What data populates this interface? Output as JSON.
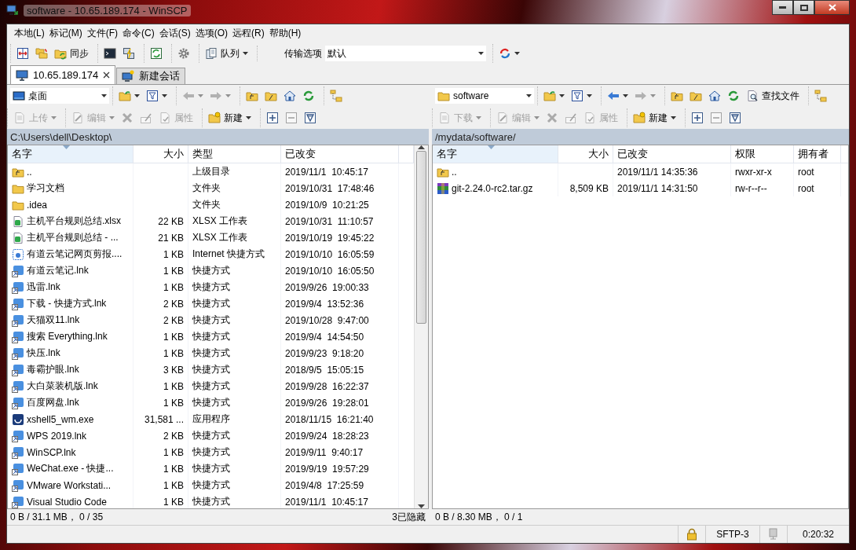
{
  "window": {
    "title": "software - 10.65.189.174 - WinSCP"
  },
  "menu": [
    "本地(L)",
    "标记(M)",
    "文件(F)",
    "命令(C)",
    "会话(S)",
    "选项(O)",
    "远程(R)",
    "帮助(H)"
  ],
  "toolbar": {
    "groups": [
      [
        {
          "kind": "compare"
        },
        {
          "kind": "sync-browse"
        },
        {
          "kind": "synchronize",
          "label": "同步"
        }
      ],
      [
        {
          "kind": "console"
        },
        {
          "kind": "external-terminal"
        }
      ],
      [
        {
          "kind": "refresh-session"
        }
      ],
      [
        {
          "kind": "preferences"
        }
      ],
      [
        {
          "kind": "queue",
          "label": "队列",
          "dropdown": true
        }
      ],
      [
        {
          "kind": "transfer",
          "label": "传输选项",
          "value": "默认"
        }
      ],
      [
        {
          "kind": "reconnect",
          "dropdown": true
        }
      ]
    ]
  },
  "tabs": [
    {
      "kind": "session",
      "label": "10.65.189.174",
      "selected": true,
      "closable": true
    },
    {
      "kind": "new-session",
      "label": "新建会话",
      "selected": false,
      "closable": false
    }
  ],
  "panels": [
    {
      "location": {
        "kind": "desktop",
        "value": "桌面"
      },
      "nav": [
        [
          {
            "kind": "open-folder",
            "disabled": false,
            "dropdown": true
          },
          {
            "kind": "filter",
            "disabled": false,
            "dropdown": true
          }
        ],
        [
          {
            "kind": "back",
            "disabled": true,
            "dropdown": true
          },
          {
            "kind": "forward",
            "disabled": true,
            "dropdown": true
          }
        ],
        [
          {
            "kind": "parent-folder",
            "disabled": false
          },
          {
            "kind": "root-folder",
            "disabled": false
          },
          {
            "kind": "home",
            "disabled": false
          },
          {
            "kind": "refresh",
            "disabled": false
          }
        ],
        [
          {
            "kind": "tree",
            "disabled": false
          }
        ]
      ],
      "actions": [
        [
          {
            "kind": "upload",
            "label": "上传",
            "disabled": true,
            "dropdown": true
          }
        ],
        [
          {
            "kind": "edit",
            "label": "编辑",
            "disabled": true,
            "dropdown": true
          },
          {
            "kind": "delete",
            "disabled": true
          },
          {
            "kind": "rename",
            "disabled": true
          },
          {
            "kind": "properties",
            "label": "属性",
            "disabled": true
          }
        ],
        [
          {
            "kind": "new",
            "label": "新建",
            "disabled": false,
            "dropdown": true
          }
        ],
        [
          {
            "kind": "select",
            "disabled": false
          },
          {
            "kind": "deselect",
            "disabled": true
          },
          {
            "kind": "select-filter",
            "disabled": false
          }
        ]
      ],
      "path": "C:\\Users\\dell\\Desktop\\",
      "columns": [
        {
          "kind": "name",
          "label": "名字",
          "sorted": true
        },
        {
          "kind": "size",
          "label": "大小",
          "sorted": false
        },
        {
          "kind": "type",
          "label": "类型",
          "sorted": false
        },
        {
          "kind": "modified",
          "label": "已改变",
          "sorted": false
        }
      ],
      "scrollbar": true,
      "rows": [
        {
          "kind": "parent",
          "selected": false,
          "name": "..",
          "type": "上级目录",
          "modified": "2019/11/1  10:45:17"
        },
        {
          "kind": "folder",
          "selected": false,
          "name": "学习文档",
          "type": "文件夹",
          "modified": "2019/10/31  17:48:46"
        },
        {
          "kind": "folder",
          "selected": false,
          "name": ".idea",
          "type": "文件夹",
          "modified": "2019/10/9  10:21:25"
        },
        {
          "kind": "spreadsheet",
          "selected": false,
          "name": "主机平台规则总结.xlsx",
          "size": "22 KB",
          "type": "XLSX 工作表",
          "modified": "2019/10/31  11:10:57"
        },
        {
          "kind": "spreadsheet",
          "selected": false,
          "name": "主机平台规则总结 - ...",
          "size": "21 KB",
          "type": "XLSX 工作表",
          "modified": "2019/10/19  19:45:22"
        },
        {
          "kind": "web-clip",
          "selected": false,
          "name": "有道云笔记网页剪报....",
          "size": "1 KB",
          "type": "Internet 快捷方式",
          "modified": "2019/10/10  16:05:59"
        },
        {
          "kind": "shortcut",
          "selected": false,
          "name": "有道云笔记.lnk",
          "size": "1 KB",
          "type": "快捷方式",
          "modified": "2019/10/10  16:05:50"
        },
        {
          "kind": "shortcut",
          "selected": false,
          "name": "迅雷.lnk",
          "size": "1 KB",
          "type": "快捷方式",
          "modified": "2019/9/26  19:00:33"
        },
        {
          "kind": "shortcut",
          "selected": false,
          "name": "下载 - 快捷方式.lnk",
          "size": "2 KB",
          "type": "快捷方式",
          "modified": "2019/9/4  13:52:36"
        },
        {
          "kind": "shortcut",
          "selected": false,
          "name": "天猫双11.lnk",
          "size": "2 KB",
          "type": "快捷方式",
          "modified": "2019/10/28  9:47:00"
        },
        {
          "kind": "shortcut",
          "selected": false,
          "name": "搜索 Everything.lnk",
          "size": "1 KB",
          "type": "快捷方式",
          "modified": "2019/9/4  14:54:50"
        },
        {
          "kind": "shortcut",
          "selected": false,
          "name": "快压.lnk",
          "size": "1 KB",
          "type": "快捷方式",
          "modified": "2019/9/23  9:18:20"
        },
        {
          "kind": "shortcut",
          "selected": false,
          "name": "毒霸护眼.lnk",
          "size": "3 KB",
          "type": "快捷方式",
          "modified": "2018/9/5  15:05:15"
        },
        {
          "kind": "shortcut",
          "selected": false,
          "name": "大白菜装机版.lnk",
          "size": "1 KB",
          "type": "快捷方式",
          "modified": "2019/9/28  16:22:37"
        },
        {
          "kind": "shortcut",
          "selected": false,
          "name": "百度网盘.lnk",
          "size": "1 KB",
          "type": "快捷方式",
          "modified": "2019/9/26  19:28:01"
        },
        {
          "kind": "application",
          "selected": false,
          "name": "xshell5_wm.exe",
          "size": "31,581 ...",
          "type": "应用程序",
          "modified": "2018/11/15  16:21:40"
        },
        {
          "kind": "shortcut",
          "selected": false,
          "name": "WPS 2019.lnk",
          "size": "2 KB",
          "type": "快捷方式",
          "modified": "2019/9/24  18:28:23"
        },
        {
          "kind": "shortcut",
          "selected": false,
          "name": "WinSCP.lnk",
          "size": "1 KB",
          "type": "快捷方式",
          "modified": "2019/9/11  9:40:17"
        },
        {
          "kind": "shortcut",
          "selected": false,
          "name": "WeChat.exe - 快捷...",
          "size": "1 KB",
          "type": "快捷方式",
          "modified": "2019/9/19  19:57:29"
        },
        {
          "kind": "shortcut",
          "selected": false,
          "name": "VMware Workstati...",
          "size": "1 KB",
          "type": "快捷方式",
          "modified": "2019/4/8  17:25:59"
        },
        {
          "kind": "shortcut",
          "selected": false,
          "name": "Visual Studio Code",
          "size": "1 KB",
          "type": "快捷方式",
          "modified": "2019/11/1  10:45:17"
        }
      ],
      "summary": "0 B / 31.1 MB， 0 / 35",
      "hidden_note": "3已隐藏"
    },
    {
      "location": {
        "kind": "folder",
        "value": "software"
      },
      "nav": [
        [
          {
            "kind": "open-folder",
            "disabled": false,
            "dropdown": true
          },
          {
            "kind": "filter",
            "disabled": false,
            "dropdown": true
          }
        ],
        [
          {
            "kind": "back",
            "disabled": false,
            "dropdown": true
          },
          {
            "kind": "forward",
            "disabled": true,
            "dropdown": true
          }
        ],
        [
          {
            "kind": "parent-folder",
            "disabled": false
          },
          {
            "kind": "root-folder",
            "disabled": false
          },
          {
            "kind": "home",
            "disabled": false
          },
          {
            "kind": "refresh",
            "disabled": false
          },
          {
            "kind": "find",
            "label": "查找文件",
            "disabled": false
          }
        ],
        [
          {
            "kind": "tree",
            "disabled": false
          }
        ]
      ],
      "actions": [
        [
          {
            "kind": "download",
            "label": "下载",
            "disabled": true,
            "dropdown": true
          }
        ],
        [
          {
            "kind": "edit",
            "label": "编辑",
            "disabled": true,
            "dropdown": true
          },
          {
            "kind": "delete",
            "disabled": true
          },
          {
            "kind": "rename",
            "disabled": true
          },
          {
            "kind": "properties",
            "label": "属性",
            "disabled": true
          }
        ],
        [
          {
            "kind": "new",
            "label": "新建",
            "disabled": false,
            "dropdown": true
          }
        ],
        [
          {
            "kind": "select",
            "disabled": false
          },
          {
            "kind": "deselect",
            "disabled": true
          },
          {
            "kind": "select-filter",
            "disabled": false
          }
        ]
      ],
      "path": "/mydata/software/",
      "columns": [
        {
          "kind": "name",
          "label": "名字",
          "sorted": true
        },
        {
          "kind": "size",
          "label": "大小",
          "sorted": false
        },
        {
          "kind": "modified",
          "label": "已改变",
          "sorted": false
        },
        {
          "kind": "rights",
          "label": "权限",
          "sorted": false
        },
        {
          "kind": "owner",
          "label": "拥有者",
          "sorted": false
        }
      ],
      "rows": [
        {
          "kind": "parent",
          "selected": false,
          "name": "..",
          "modified": "2019/11/1 14:35:36",
          "rights": "rwxr-xr-x",
          "owner": "root"
        },
        {
          "kind": "archive",
          "selected": false,
          "name": "git-2.24.0-rc2.tar.gz",
          "size": "8,509 KB",
          "modified": "2019/11/1 14:31:50",
          "rights": "rw-r--r--",
          "owner": "root"
        }
      ],
      "summary": "0 B / 8.30 MB， 0 / 1"
    }
  ],
  "status_bar": {
    "secure": true,
    "protocol": "SFTP-3",
    "time": "0:20:32"
  }
}
